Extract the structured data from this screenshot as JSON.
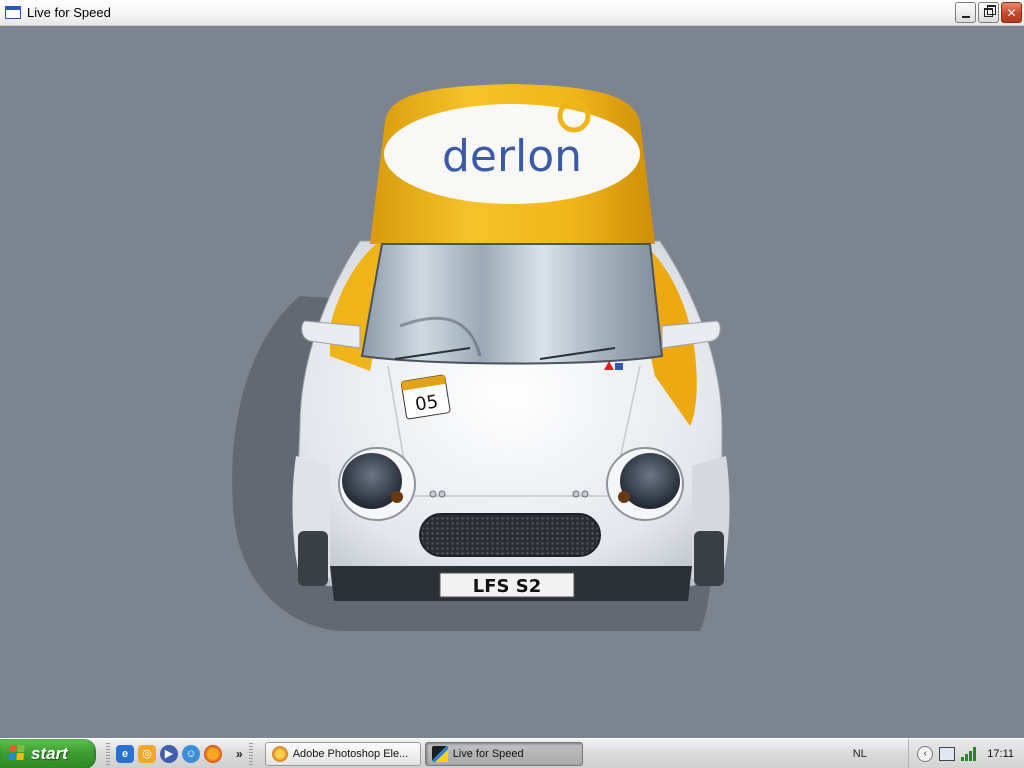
{
  "window": {
    "title": "Live for Speed",
    "controls": {
      "minimize_icon": "minimize-icon",
      "restore_icon": "restore-icon",
      "close_glyph": "✕"
    }
  },
  "scene": {
    "hood_logo": "derlon",
    "race_number": "05",
    "license_plate": "LFS S2",
    "colors": {
      "background": "#7b848f",
      "livery_yellow": "#f0b418",
      "body_white": "#eef1f4",
      "logo_blue": "#3a5ba8"
    }
  },
  "taskbar": {
    "start_label": "start",
    "quick_launch": [
      {
        "icon": "ie-icon"
      },
      {
        "icon": "outlook-icon"
      },
      {
        "icon": "media-player-icon"
      },
      {
        "icon": "messenger-icon"
      },
      {
        "icon": "firefox-icon"
      }
    ],
    "chevron": "»",
    "tasks": [
      {
        "label": "Adobe Photoshop Ele...",
        "icon": "photoshop-icon",
        "active": false
      },
      {
        "label": "Live for Speed",
        "icon": "lfs-icon",
        "active": true
      }
    ],
    "language": "NL",
    "clock": "17:11"
  }
}
